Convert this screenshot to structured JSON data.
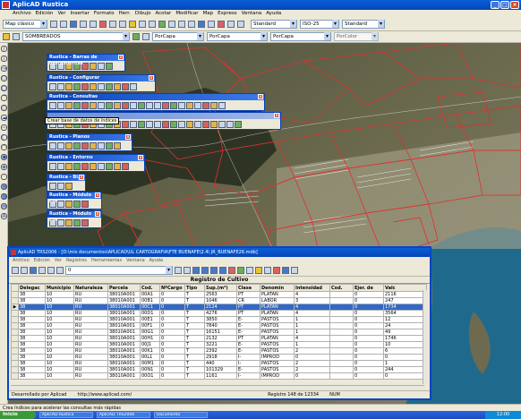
{
  "app": {
    "title": "AplicAD Rustica",
    "menu": [
      "Archivo",
      "Edición",
      "Ver",
      "Insertar",
      "Formato",
      "Herr.",
      "Dibujo",
      "Acotar",
      "Modificar",
      "Map",
      "Express",
      "Ventana",
      "Ayuda"
    ]
  },
  "toolbar1": {
    "view_combo": "Map clásico",
    "style_combo": "Standard",
    "dim_combo": "ISO-25",
    "table_combo": "Standard"
  },
  "toolbar2": {
    "layer_combo": "SOMBREADOS",
    "color_combo": "PorCapa",
    "linetype_combo": "PorCapa",
    "lineweight_combo": "PorCapa",
    "plot_combo": "PorColor"
  },
  "panels": [
    {
      "title": "Rustica - Barras de herramientas"
    },
    {
      "title": "Rustica - Configurar"
    },
    {
      "title": "Rustica - Consultas"
    },
    {
      "title": "Rustica - Planos"
    },
    {
      "title": "Rustica - Entorno"
    },
    {
      "title": "Rustica - Bl..."
    },
    {
      "title": "Rustica - Módulo FIN"
    },
    {
      "title": "Rustica - Módulo FIN"
    }
  ],
  "tooltip": "Crear base de datos de índices",
  "db_window": {
    "title": "AplicAD TRS2006 - [D:\\mis documentos\\APLICAD\\UL CARTOGRAFIA\\FTE BUENAFE\\2.4\\ JR_BUENAFE26.mdb]",
    "menu": [
      "Archivo",
      "Edición",
      "Ver",
      "Registros",
      "Herramientas",
      "Ventana",
      "Ayuda"
    ],
    "record_combo": "0",
    "caption": "Registro de Cultivo",
    "columns": [
      "Delegac",
      "Municipio",
      "Naturaleza",
      "Parcela",
      "Cod.",
      "NºCargo",
      "Tipo",
      "Sup.(m²)",
      "Clase",
      "Denomin",
      "Intensidad",
      "Cod.",
      "Ejer. de",
      "Valc"
    ],
    "rows": [
      [
        "38",
        "10",
        "RU",
        "38010A001",
        "00A1",
        "0",
        "T",
        "2563",
        "PT",
        "PLATAN",
        "4",
        "",
        "0",
        "2116"
      ],
      [
        "38",
        "10",
        "RU",
        "38010A001",
        "00B1",
        "0",
        "T",
        "1046",
        "CR",
        "LABOR",
        "3",
        "",
        "0",
        "247"
      ],
      [
        "38",
        "10",
        "RU",
        "38010A001",
        "00C1",
        "0",
        "T",
        "2124",
        "PT",
        "PLATAN",
        "4",
        "",
        "0",
        "1734"
      ],
      [
        "38",
        "10",
        "RU",
        "38010A001",
        "00D1",
        "0",
        "T",
        "4276",
        "PT",
        "PLATAN",
        "4",
        "",
        "0",
        "3564"
      ],
      [
        "38",
        "10",
        "RU",
        "38010A001",
        "00E1",
        "0",
        "T",
        "3850",
        "E-",
        "PASTOS",
        "1",
        "",
        "0",
        "12"
      ],
      [
        "38",
        "10",
        "RU",
        "38010A001",
        "00F1",
        "0",
        "T",
        "7840",
        "E-",
        "PASTOS",
        "1",
        "",
        "0",
        "24"
      ],
      [
        "38",
        "10",
        "RU",
        "38010A001",
        "00G1",
        "0",
        "T",
        "16151",
        "E-",
        "PASTOS",
        "1",
        "",
        "0",
        "49"
      ],
      [
        "38",
        "10",
        "RU",
        "38010A001",
        "00H1",
        "0",
        "T",
        "2132",
        "PT",
        "PLATAN",
        "4",
        "",
        "0",
        "1746"
      ],
      [
        "38",
        "10",
        "RU",
        "38010A001",
        "00J1",
        "0",
        "T",
        "3221",
        "E-",
        "PASTOS",
        "1",
        "",
        "0",
        "10"
      ],
      [
        "38",
        "10",
        "RU",
        "38010A001",
        "00K1",
        "0",
        "T",
        "2392",
        "E-",
        "PASTOS",
        "2",
        "",
        "0",
        "6"
      ],
      [
        "38",
        "10",
        "RU",
        "38010A001",
        "00L1",
        "0",
        "T",
        "2918",
        "I-",
        "IMPROD",
        "0",
        "",
        "0",
        "0"
      ],
      [
        "38",
        "10",
        "RU",
        "38010A001",
        "00M1",
        "0",
        "T",
        "440",
        "I-",
        "PASTOS",
        "2",
        "",
        "0",
        "1"
      ],
      [
        "38",
        "10",
        "RU",
        "38010A001",
        "00N1",
        "0",
        "T",
        "101329",
        "E-",
        "PASTOS",
        "2",
        "",
        "0",
        "244"
      ],
      [
        "38",
        "10",
        "RU",
        "38010A001",
        "00O1",
        "0",
        "T",
        "1161",
        "I-",
        "IMPROD",
        "0",
        "",
        "0",
        "0"
      ]
    ],
    "active_row": 2,
    "status_left": "Desarrollado por Aplicad",
    "status_url": "http://www.aplicad.com/",
    "status_record": "Registro 148 de 12334",
    "status_mode": "NUM"
  },
  "statusbar": "Crea índices para acelerar las consultas más rápidas",
  "taskbar": {
    "start": "Inicio",
    "tasks": [
      "AplicAD Rustica",
      "AplicAD TRS2006",
      "Documento"
    ],
    "clock": "12:00"
  },
  "colors": {
    "accent": "#0a45c0",
    "selection": "#3169c6",
    "parcel_lines": "#e03030"
  }
}
